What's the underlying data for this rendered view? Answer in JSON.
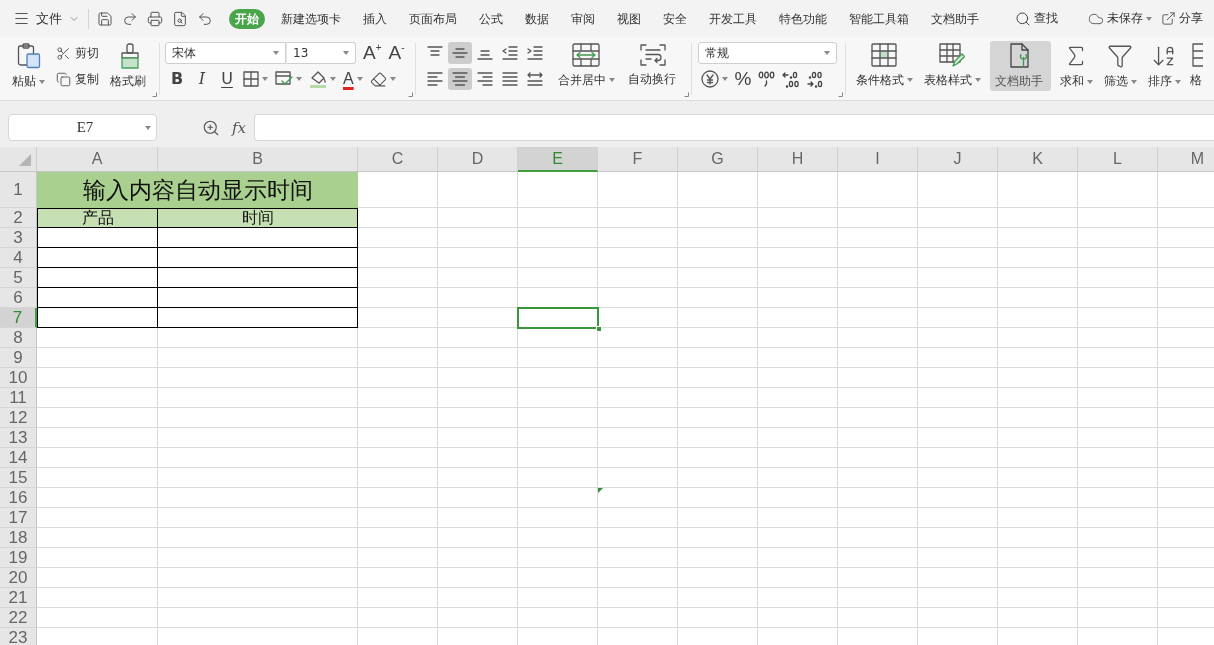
{
  "menu_bar": {
    "file_menu": "文件",
    "tabs": [
      {
        "label": "开始",
        "selected": true
      },
      {
        "label": "新建选项卡",
        "selected": false
      },
      {
        "label": "插入",
        "selected": false
      },
      {
        "label": "页面布局",
        "selected": false
      },
      {
        "label": "公式",
        "selected": false
      },
      {
        "label": "数据",
        "selected": false
      },
      {
        "label": "审阅",
        "selected": false
      },
      {
        "label": "视图",
        "selected": false
      },
      {
        "label": "安全",
        "selected": false
      },
      {
        "label": "开发工具",
        "selected": false
      },
      {
        "label": "特色功能",
        "selected": false
      },
      {
        "label": "智能工具箱",
        "selected": false
      },
      {
        "label": "文档助手",
        "selected": false
      }
    ],
    "find": "查找",
    "save_status": "未保存",
    "share": "分享"
  },
  "ribbon": {
    "paste": "粘贴",
    "cut": "剪切",
    "copy": "复制",
    "format_painter": "格式刷",
    "font_name": "宋体",
    "font_size": "13",
    "grow_font": "A$^{+}$",
    "shrink_font": "A$^{-}$",
    "text_styles": [
      {
        "kind": "bold",
        "label": "B"
      },
      {
        "kind": "italic",
        "label": "I"
      },
      {
        "kind": "underline",
        "label": "U"
      }
    ],
    "font_color": "A",
    "alignment": [
      {
        "kind": "top",
        "selected": false
      },
      {
        "kind": "middle",
        "selected": true
      },
      {
        "kind": "bottom",
        "selected": false
      },
      {
        "kind": "outdent",
        "selected": false
      },
      {
        "kind": "indent",
        "selected": false
      },
      {
        "kind": "left",
        "selected": false
      },
      {
        "kind": "center",
        "selected": true
      },
      {
        "kind": "right",
        "selected": false
      },
      {
        "kind": "justify",
        "selected": false
      },
      {
        "kind": "distributed",
        "selected": false
      }
    ],
    "merge": "合并居中",
    "wrap_text": "自动换行",
    "number_format": "常规",
    "percent": "%",
    "conditional_format": "条件格式",
    "table_style": "表格样式",
    "doc_assistant": {
      "label": "文档助手",
      "selected": true
    },
    "sum": "求和",
    "filter": "筛选",
    "sort": "排序",
    "partial_button": "格"
  },
  "formula_bar": {
    "name_box": "E7",
    "function_button": "fx"
  },
  "sheet": {
    "columns": [
      {
        "label": "A",
        "selected": false,
        "flagged": false
      },
      {
        "label": "B",
        "selected": false,
        "flagged": false
      },
      {
        "label": "C",
        "selected": false,
        "flagged": false
      },
      {
        "label": "D",
        "selected": false,
        "flagged": false
      },
      {
        "label": "E",
        "selected": true,
        "flagged": false
      },
      {
        "label": "F",
        "selected": false,
        "flagged": true
      },
      {
        "label": "G",
        "selected": false,
        "flagged": false
      },
      {
        "label": "H",
        "selected": false,
        "flagged": false
      },
      {
        "label": "I",
        "selected": false,
        "flagged": false
      },
      {
        "label": "J",
        "selected": false,
        "flagged": false
      },
      {
        "label": "K",
        "selected": false,
        "flagged": false
      },
      {
        "label": "L",
        "selected": false,
        "flagged": false
      },
      {
        "label": "M",
        "selected": false,
        "flagged": false
      }
    ],
    "rows": [
      {
        "label": "1",
        "selected": false,
        "flagged": false
      },
      {
        "label": "2",
        "selected": false,
        "flagged": false
      },
      {
        "label": "3",
        "selected": false,
        "flagged": false
      },
      {
        "label": "4",
        "selected": false,
        "flagged": false
      },
      {
        "label": "5",
        "selected": false,
        "flagged": false
      },
      {
        "label": "6",
        "selected": false,
        "flagged": false
      },
      {
        "label": "7",
        "selected": true,
        "flagged": false
      },
      {
        "label": "8",
        "selected": false,
        "flagged": false
      },
      {
        "label": "9",
        "selected": false,
        "flagged": false
      },
      {
        "label": "10",
        "selected": false,
        "flagged": false
      },
      {
        "label": "11",
        "selected": false,
        "flagged": false
      },
      {
        "label": "12",
        "selected": false,
        "flagged": false
      },
      {
        "label": "13",
        "selected": false,
        "flagged": false
      },
      {
        "label": "14",
        "selected": false,
        "flagged": false
      },
      {
        "label": "15",
        "selected": false,
        "flagged": false
      },
      {
        "label": "16",
        "selected": false,
        "flagged": true
      },
      {
        "label": "17",
        "selected": false,
        "flagged": false
      },
      {
        "label": "18",
        "selected": false,
        "flagged": false
      },
      {
        "label": "19",
        "selected": false,
        "flagged": false
      },
      {
        "label": "20",
        "selected": false,
        "flagged": false
      },
      {
        "label": "21",
        "selected": false,
        "flagged": false
      },
      {
        "label": "22",
        "selected": false,
        "flagged": false
      },
      {
        "label": "23",
        "selected": false,
        "flagged": false
      }
    ],
    "title": "输入内容自动显示时间",
    "headers": [
      "产品",
      "时间"
    ]
  }
}
